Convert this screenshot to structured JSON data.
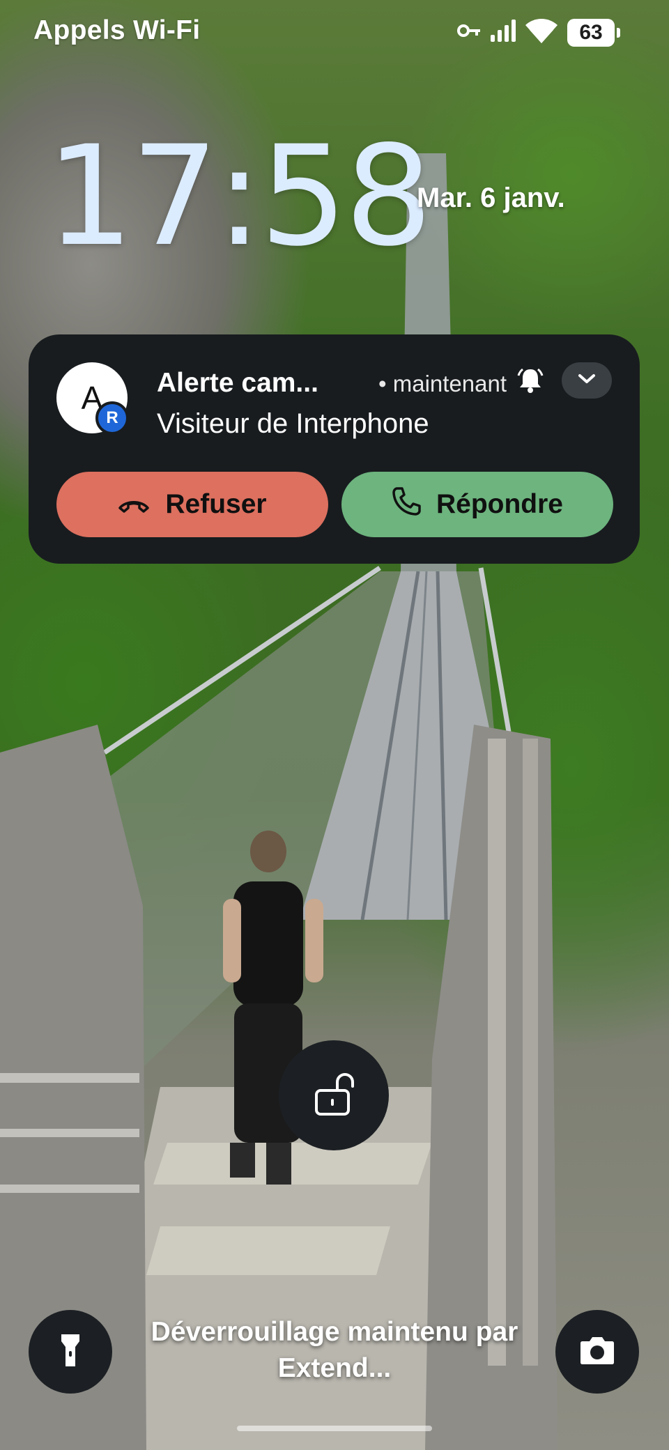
{
  "status_bar": {
    "carrier": "Appels Wi-Fi",
    "battery": "63",
    "icons": [
      "vpn-key-icon",
      "signal-icon",
      "wifi-icon",
      "battery-icon"
    ]
  },
  "lockscreen": {
    "time": "17:58",
    "date": "Mar. 6 janv.",
    "unlock_status": "Déverrouillage maintenu par Extend..."
  },
  "notification": {
    "avatar_letter": "A",
    "badge_letter": "R",
    "title": "Alerte cam...",
    "time": "maintenant",
    "body": "Visiteur de Interphone",
    "decline_label": "Refuser",
    "answer_label": "Répondre",
    "colors": {
      "background": "#181c1f",
      "decline": "#dd705f",
      "answer": "#6db47e",
      "badge": "#1f67d8"
    }
  },
  "colors": {
    "clock": "#dcecff",
    "button_bg": "#1c2024"
  }
}
